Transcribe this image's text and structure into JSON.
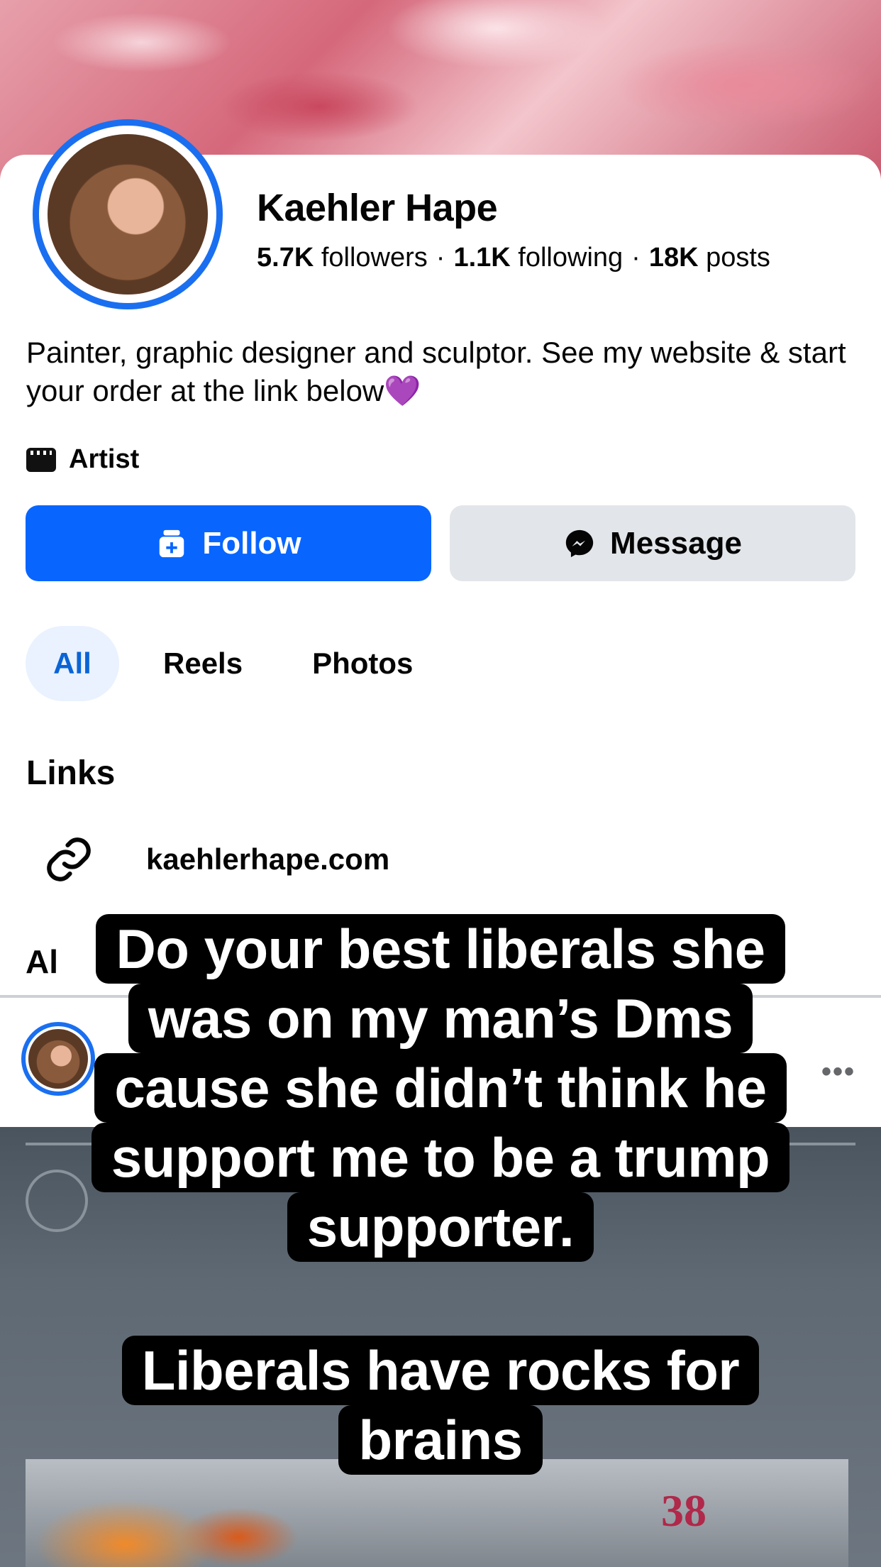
{
  "profile": {
    "name": "Kaehler Hape",
    "followers_count": "5.7K",
    "followers_label": "followers",
    "following_count": "1.1K",
    "following_label": "following",
    "posts_count": "18K",
    "posts_label": "posts",
    "separator": "·",
    "bio": "Painter, graphic designer and sculptor. See my website & start your order at the link below💜",
    "category": "Artist"
  },
  "actions": {
    "follow_label": "Follow",
    "message_label": "Message"
  },
  "tabs": [
    {
      "label": "All",
      "active": true
    },
    {
      "label": "Reels",
      "active": false
    },
    {
      "label": "Photos",
      "active": false
    }
  ],
  "links": {
    "heading": "Links",
    "items": [
      {
        "text": "kaehlerhape.com",
        "icon": "link-icon"
      }
    ]
  },
  "section": {
    "partial_label": "Al"
  },
  "post": {
    "more_label": "•••",
    "photo_text": "38"
  },
  "overlay": {
    "lines": [
      "Do your best liberals she",
      "was on my man’s Dms",
      "cause she didn’t think he",
      "support me to be a trump",
      "supporter."
    ],
    "lines2": [
      "Liberals have rocks for",
      "brains"
    ]
  },
  "colors": {
    "accent": "#0866ff",
    "active_tab_bg": "#e9f2fe",
    "active_tab_text": "#0a64d6",
    "message_bg": "#e2e5e9"
  }
}
